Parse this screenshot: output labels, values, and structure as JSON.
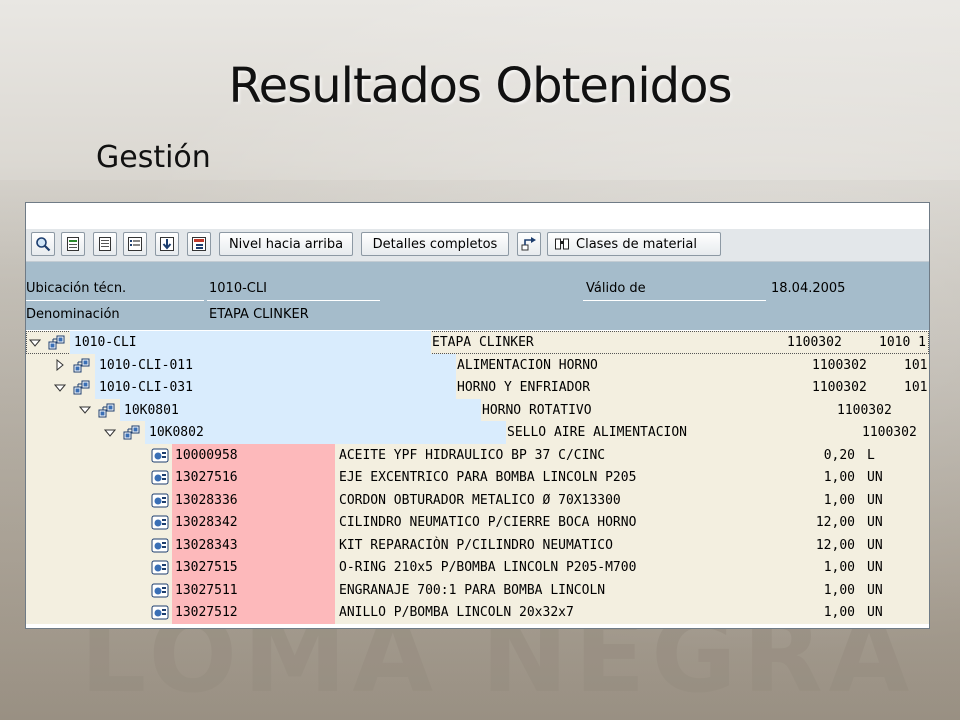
{
  "slide": {
    "title": "Resultados Obtenidos",
    "subtitle": "Gestión",
    "watermark": "LOMA NEGRA"
  },
  "toolbar": {
    "icons": [
      "find-icon",
      "document-icon",
      "document-list-icon",
      "list-icon",
      "download-icon",
      "hierarchy-icon"
    ],
    "level_up_label": "Nivel hacia arriba",
    "full_details_label": "Detalles completos",
    "material_classes_icon": "navigation-icon",
    "material_classes_label": "Clases de material"
  },
  "header": {
    "location_label": "Ubicación técn.",
    "location_value": "1010-CLI",
    "valid_from_label": "Válido de",
    "valid_from_value": "18.04.2005",
    "denomination_label": "Denominación",
    "denomination_value": "ETAPA CLINKER"
  },
  "tree": {
    "nodes": [
      {
        "level": 0,
        "expander": "expanded",
        "id": "1010-CLI",
        "desc": "ETAPA CLINKER",
        "code": "1100302",
        "extra": "1010 1",
        "selected": true
      },
      {
        "level": 1,
        "expander": "collapsed",
        "id": "1010-CLI-011",
        "desc": "ALIMENTACION HORNO",
        "code": "1100302",
        "extra": "101"
      },
      {
        "level": 1,
        "expander": "expanded",
        "id": "1010-CLI-031",
        "desc": "HORNO Y ENFRIADOR",
        "code": "1100302",
        "extra": "101"
      },
      {
        "level": 2,
        "expander": "expanded",
        "id": "10K0801",
        "desc": "HORNO ROTATIVO",
        "code": "1100302",
        "extra": ""
      },
      {
        "level": 3,
        "expander": "expanded",
        "id": "10K0802",
        "desc": "SELLO AIRE ALIMENTACION",
        "code": "1100302",
        "extra": ""
      }
    ],
    "materials": [
      {
        "id": "10000958",
        "desc": "ACEITE YPF HIDRAULICO BP 37 C/CINC",
        "qty": "0,20",
        "unit": "L"
      },
      {
        "id": "13027516",
        "desc": "EJE EXCENTRICO PARA BOMBA LINCOLN P205",
        "qty": "1,00",
        "unit": "UN"
      },
      {
        "id": "13028336",
        "desc": "CORDON OBTURADOR METALICO Ø 70X13300",
        "qty": "1,00",
        "unit": "UN"
      },
      {
        "id": "13028342",
        "desc": "CILINDRO NEUMATICO P/CIERRE BOCA HORNO",
        "qty": "12,00",
        "unit": "UN"
      },
      {
        "id": "13028343",
        "desc": "KIT REPARACIÒN P/CILINDRO NEUMATICO",
        "qty": "12,00",
        "unit": "UN"
      },
      {
        "id": "13027515",
        "desc": "O-RING 210x5 P/BOMBA LINCOLN P205-M700",
        "qty": "1,00",
        "unit": "UN"
      },
      {
        "id": "13027511",
        "desc": "ENGRANAJE 700:1 PARA BOMBA LINCOLN",
        "qty": "1,00",
        "unit": "UN"
      },
      {
        "id": "13027512",
        "desc": "ANILLO P/BOMBA LINCOLN 20x32x7",
        "qty": "1,00",
        "unit": "UN"
      }
    ]
  },
  "colors": {
    "header_bg": "#a5bccb",
    "node_id_bg": "#d9ecfd",
    "material_id_bg": "#fdb9bb",
    "row_bg": "#f3efe0"
  }
}
